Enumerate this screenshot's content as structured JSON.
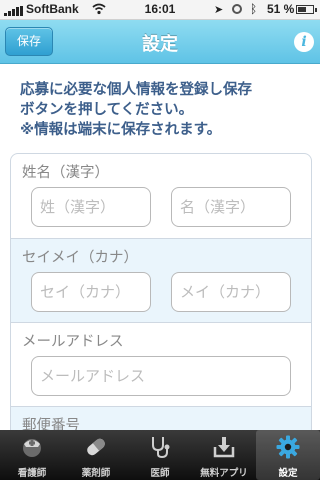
{
  "status_bar": {
    "carrier": "SoftBank",
    "time": "16:01",
    "battery": "51 %"
  },
  "navbar": {
    "save_label": "保存",
    "title": "設定",
    "info_label": "i"
  },
  "intro_text": "応募に必要な個人情報を登録し保存\nボタンを押してください。\n※情報は端末に保存されます。",
  "form": {
    "name_kanji": {
      "label": "姓名（漢字）",
      "last_placeholder": "姓（漢字）",
      "first_placeholder": "名（漢字）"
    },
    "name_kana": {
      "label": "セイメイ（カナ）",
      "last_placeholder": "セイ（カナ）",
      "first_placeholder": "メイ（カナ）"
    },
    "email": {
      "label": "メールアドレス",
      "placeholder": "メールアドレス"
    },
    "postal": {
      "label": "郵便番号"
    }
  },
  "tabs": [
    {
      "label": "看護師",
      "icon": "nurse-cap-icon"
    },
    {
      "label": "薬剤師",
      "icon": "pill-icon"
    },
    {
      "label": "医師",
      "icon": "stethoscope-icon"
    },
    {
      "label": "無料アプリ",
      "icon": "download-icon"
    },
    {
      "label": "設定",
      "icon": "gear-icon",
      "active": true
    }
  ],
  "colors": {
    "navbar": "#5fc3e6",
    "intro_text": "#3d5f8b",
    "alt_section": "#eaf5fc",
    "active_icon": "#3aa8e0"
  }
}
